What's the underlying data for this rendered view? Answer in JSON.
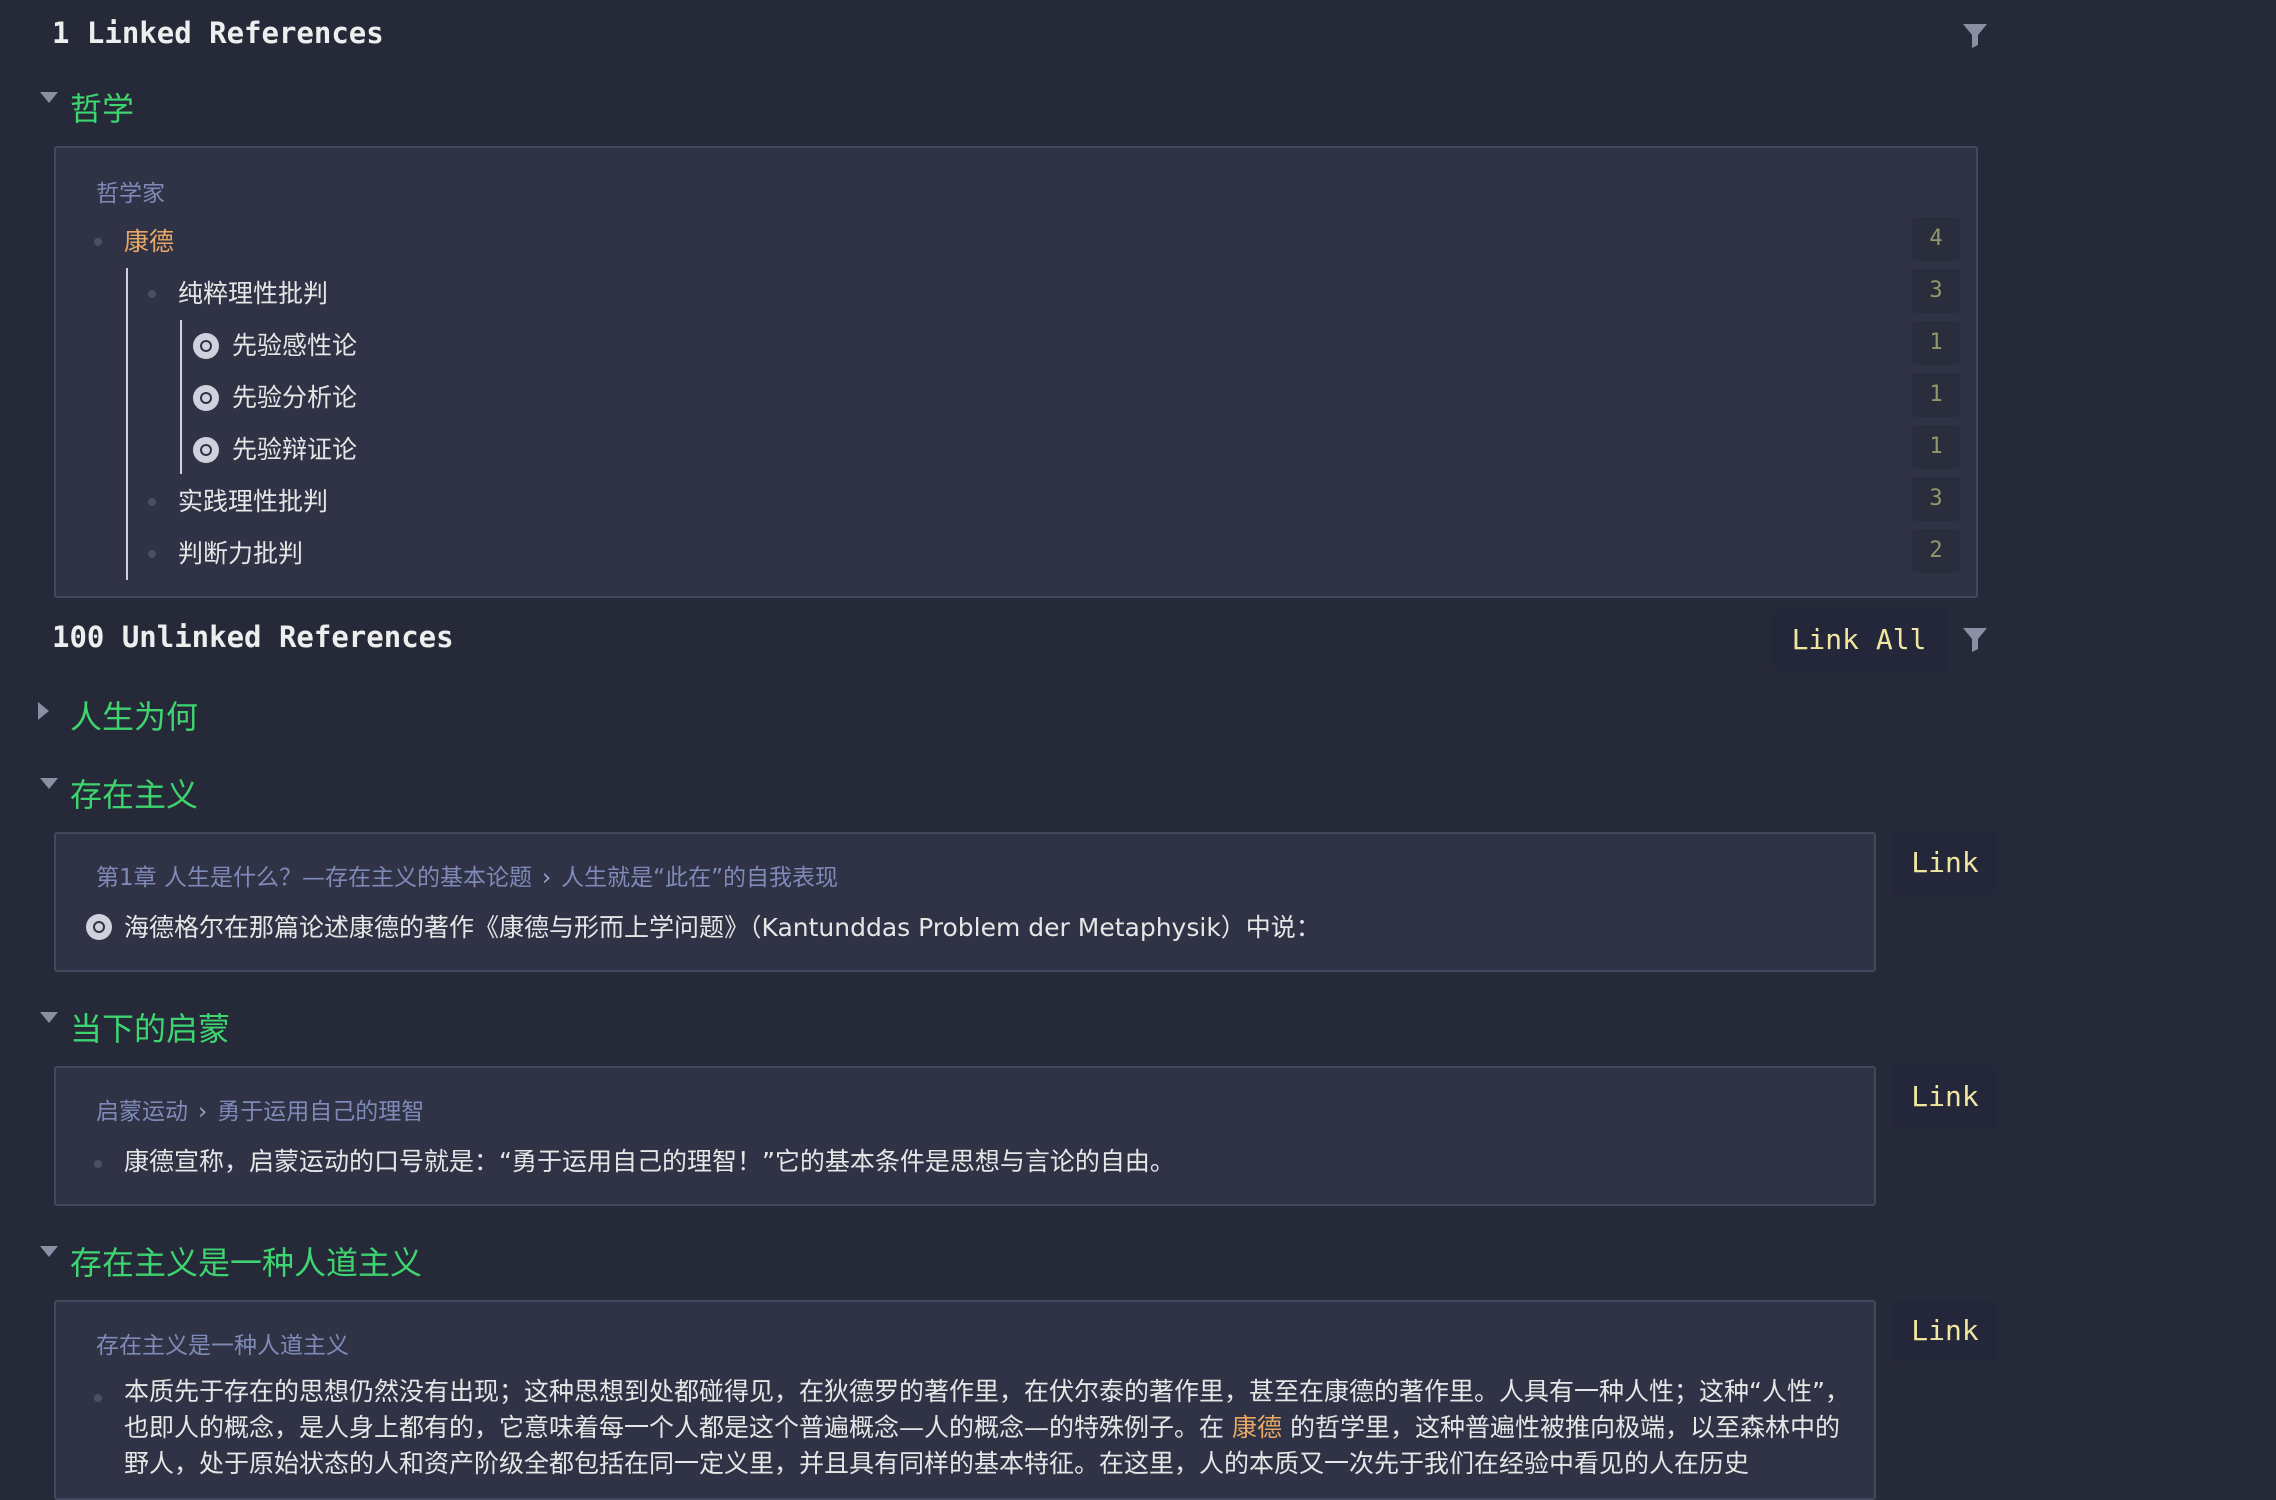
{
  "linked": {
    "title": "1 Linked References",
    "group": {
      "page": "哲学",
      "breadcrumb": "哲学家",
      "items": [
        {
          "label": "康德",
          "count": "4"
        },
        {
          "label": "纯粹理性批判",
          "count": "3"
        },
        {
          "label": "先验感性论",
          "count": "1"
        },
        {
          "label": "先验分析论",
          "count": "1"
        },
        {
          "label": "先验辩证论",
          "count": "1"
        },
        {
          "label": "实践理性批判",
          "count": "3"
        },
        {
          "label": "判断力批判",
          "count": "2"
        }
      ]
    }
  },
  "unlinked": {
    "title": "100 Unlinked References",
    "link_all_label": "Link All",
    "link_label": "Link",
    "groups": [
      {
        "page": "人生为何"
      },
      {
        "page": "存在主义",
        "breadcrumb": [
          "第1章  人生是什么？—存在主义的基本论题",
          "人生就是“此在”的自我表现"
        ],
        "text": "海德格尔在那篇论述康德的著作《康德与形而上学问题》（Kantunddas Problem der Metaphysik）中说："
      },
      {
        "page": "当下的启蒙",
        "breadcrumb": [
          "启蒙运动",
          "勇于运用自己的理智"
        ],
        "text": "康德宣称，启蒙运动的口号就是：“勇于运用自己的理智！”它的基本条件是思想与言论的自由。"
      },
      {
        "page": "存在主义是一种人道主义",
        "breadcrumb": [
          "存在主义是一种人道主义"
        ],
        "text_before": "本质先于存在的思想仍然没有出现；这种思想到处都碰得见，在狄德罗的著作里，在伏尔泰的著作里，甚至在康德的著作里。人具有一种人性；这种“人性”，也即人的概念，是人身上都有的，它意味着每一个人都是这个普遍概念—人的概念—的特殊例子。在",
        "highlight": "康德",
        "text_after": "的哲学里，这种普遍性被推向极端，以至森林中的野人，处于原始状态的人和资产阶级全都包括在同一定义里，并且具有同样的基本特征。在这里，人的本质又一次先于我们在经验中看见的人在历史"
      }
    ]
  },
  "colors": {
    "background": "#262938",
    "card": "#303345",
    "page_title": "#3ed46f",
    "breadcrumb": "#7f8ab8",
    "highlight": "#e8a766",
    "link_button_text": "#f0e6a0"
  },
  "icons": [
    "filter-icon",
    "caret-down-icon",
    "caret-right-icon",
    "chevron-right-icon",
    "bullet-icon"
  ]
}
